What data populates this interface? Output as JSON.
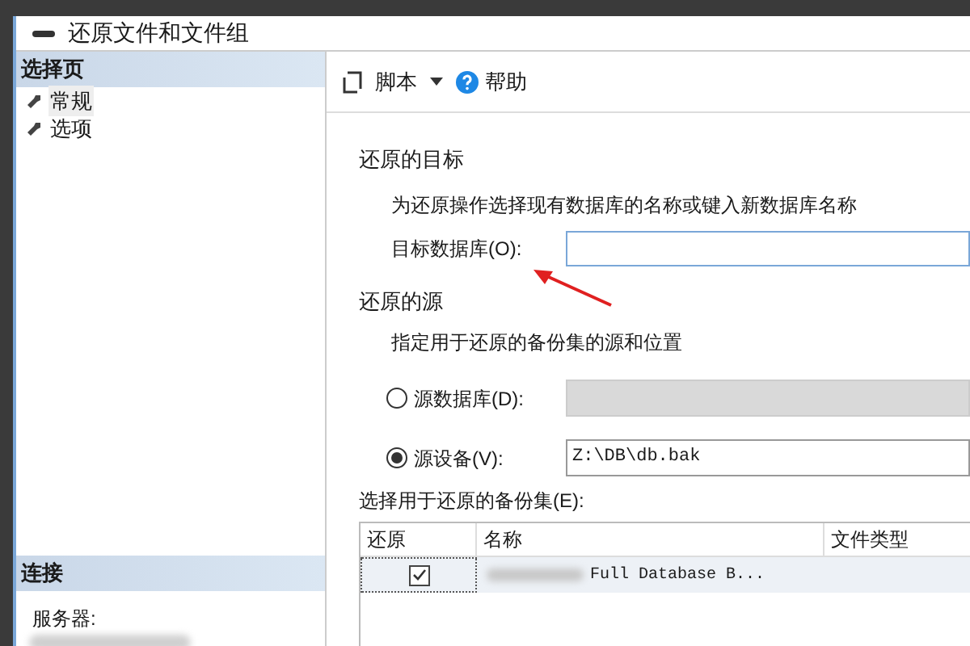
{
  "window": {
    "title": "还原文件和文件组"
  },
  "sidebar": {
    "header": "选择页",
    "items": [
      {
        "label": "常规",
        "selected": true
      },
      {
        "label": "选项",
        "selected": false
      }
    ],
    "connection_header": "连接",
    "server_label": "服务器:"
  },
  "toolbar": {
    "script": "脚本",
    "help": "帮助"
  },
  "destination": {
    "heading": "还原的目标",
    "description": "为还原操作选择现有数据库的名称或键入新数据库名称",
    "label": "目标数据库(O):"
  },
  "source": {
    "heading": "还原的源",
    "description": "指定用于还原的备份集的源和位置",
    "options": [
      {
        "label": "源数据库(D):",
        "selected": false,
        "disabled": true
      },
      {
        "label": "源设备(V):",
        "selected": true,
        "disabled": false,
        "value": "Z:\\DB\\db.bak"
      }
    ]
  },
  "backup_sets": {
    "label": "选择用于还原的备份集(E):",
    "columns": [
      "还原",
      "名称",
      "文件类型"
    ],
    "rows": [
      {
        "checked": true,
        "name": "Full Database B..."
      }
    ]
  }
}
